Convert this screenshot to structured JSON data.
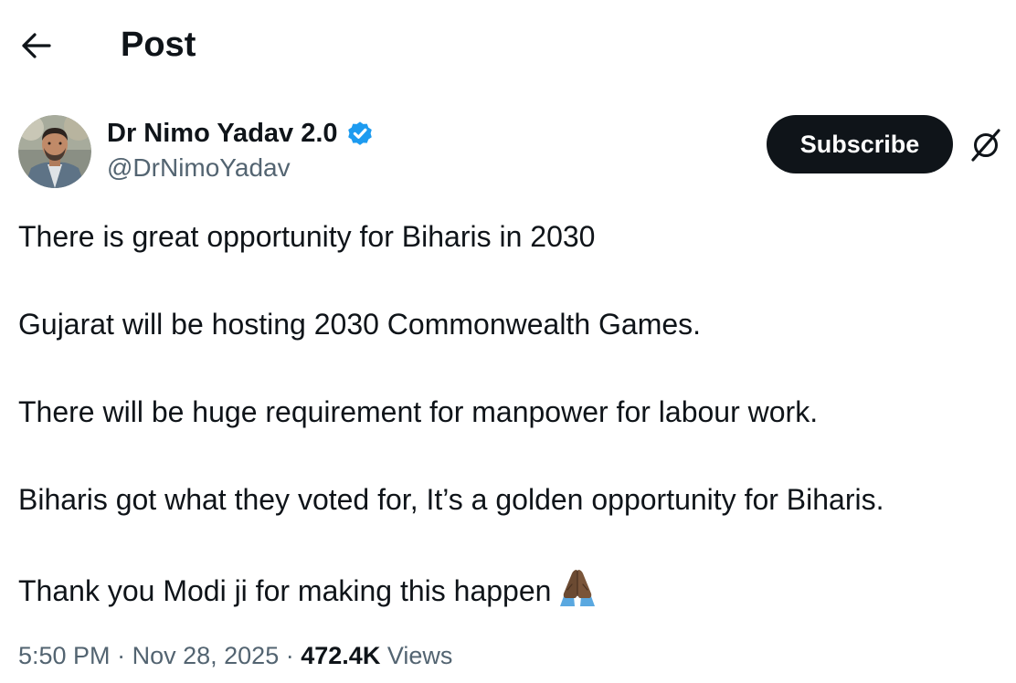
{
  "header": {
    "back_icon": "arrow-left-icon",
    "title": "Post"
  },
  "author": {
    "display_name": "Dr Nimo Yadav 2.0",
    "handle": "@DrNimoYadav",
    "verified_icon": "verified-badge-icon",
    "verified_color": "#1d9bf0"
  },
  "actions": {
    "subscribe_label": "Subscribe",
    "grok_icon": "grok-icon"
  },
  "tweet": {
    "lines": [
      "There is great opportunity for Biharis in 2030",
      "Gujarat will be hosting 2030 Commonwealth Games.",
      "There will be huge requirement for manpower for labour work.",
      "Biharis got what they voted for, It’s a golden opportunity for Biharis.",
      "Thank you Modi ji for making this happen"
    ],
    "emoji_icon": "folded-hands-icon"
  },
  "meta": {
    "time": "5:50 PM",
    "separator": "·",
    "date": "Nov 28, 2025",
    "views_count": "472.4K",
    "views_label": "Views"
  },
  "colors": {
    "text_primary": "#0f1419",
    "text_secondary": "#536471",
    "button_bg": "#0f1419",
    "button_text": "#ffffff"
  }
}
